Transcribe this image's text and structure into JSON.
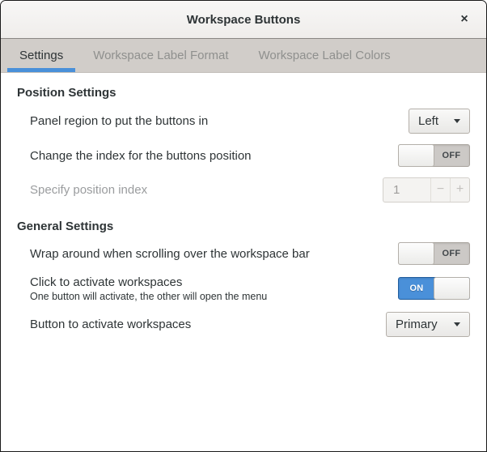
{
  "window": {
    "title": "Workspace Buttons",
    "close_glyph": "×"
  },
  "tabs": {
    "settings": "Settings",
    "label_format": "Workspace Label Format",
    "label_colors": "Workspace Label Colors"
  },
  "position_section": {
    "header": "Position Settings",
    "panel_region": {
      "label": "Panel region to put the buttons in",
      "value": "Left"
    },
    "change_index": {
      "label": "Change the index for the buttons position",
      "state": "OFF"
    },
    "position_index": {
      "label": "Specify position index",
      "value": "1",
      "minus_glyph": "−",
      "plus_glyph": "+"
    }
  },
  "general_section": {
    "header": "General Settings",
    "wrap_around": {
      "label": "Wrap around when scrolling over the workspace bar",
      "state": "OFF"
    },
    "click_activate": {
      "label": "Click to activate workspaces",
      "description": "One button will activate, the other will open the menu",
      "state": "ON"
    },
    "activate_button": {
      "label": "Button to activate workspaces",
      "value": "Primary"
    }
  },
  "colors": {
    "accent": "#4a90d9",
    "switch_on_bg": "#4a90d9",
    "switch_on_border": "#215d9c",
    "tab_underline": "#4a90d9",
    "titlebar_bg": "#f5f4f2",
    "tabbar_bg": "#d1cdc9"
  }
}
